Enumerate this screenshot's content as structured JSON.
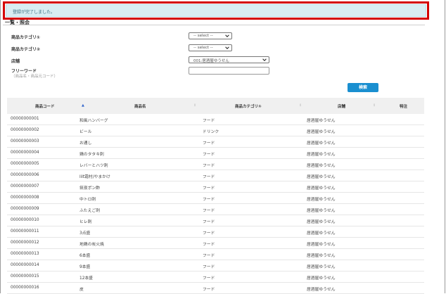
{
  "banner": {
    "message": "登録が完了しました。"
  },
  "section": {
    "title": "一覧・照会"
  },
  "filters": {
    "category1": {
      "label": "商品カテゴリ①",
      "value": "-- select --"
    },
    "category2": {
      "label": "商品カテゴリ②",
      "value": "-- select --"
    },
    "store": {
      "label": "店舗",
      "value": "001:居酒屋ゆうせん"
    },
    "freeword": {
      "label": "フリーワード",
      "sublabel": "（商品名・商品元コード）",
      "value": ""
    },
    "search_label": "検索"
  },
  "table": {
    "columns": [
      "商品コード",
      "商品名",
      "商品カテゴリ①",
      "店舗",
      "特注"
    ],
    "rows": [
      [
        "00000000001",
        "和風ハンバーグ",
        "フード",
        "居酒屋ゆうせん"
      ],
      [
        "00000000002",
        "ビール",
        "ドリンク",
        "居酒屋ゆうせん"
      ],
      [
        "00000000003",
        "お通し",
        "フード",
        "居酒屋ゆうせん"
      ],
      [
        "00000000004",
        "鶏のタタキ刺",
        "フード",
        "居酒屋ゆうせん"
      ],
      [
        "00000000005",
        "レバーとハツ刺",
        "フード",
        "居酒屋ゆうせん"
      ],
      [
        "00000000006",
        "lilt霜村/やまかけ",
        "フード",
        "居酒屋ゆうせん"
      ],
      [
        "00000000007",
        "筑夜ポン酢",
        "フード",
        "居酒屋ゆうせん"
      ],
      [
        "00000000008",
        "中トロ刺",
        "フード",
        "居酒屋ゆうせん"
      ],
      [
        "00000000009",
        "ふたえご刺",
        "フード",
        "居酒屋ゆうせん"
      ],
      [
        "00000000010",
        "ヒレ刺",
        "フード",
        "居酒屋ゆうせん"
      ],
      [
        "00000000011",
        "3点盛",
        "フード",
        "居酒屋ゆうせん"
      ],
      [
        "00000000012",
        "地鶏の炭火焼",
        "フード",
        "居酒屋ゆうせん"
      ],
      [
        "00000000013",
        "6本盛",
        "フード",
        "居酒屋ゆうせん"
      ],
      [
        "00000000014",
        "9本盛",
        "フード",
        "居酒屋ゆうせん"
      ],
      [
        "00000000015",
        "12本盛",
        "フード",
        "居酒屋ゆうせん"
      ],
      [
        "00000000016",
        "皮",
        "フード",
        "居酒屋ゆうせん"
      ]
    ]
  }
}
